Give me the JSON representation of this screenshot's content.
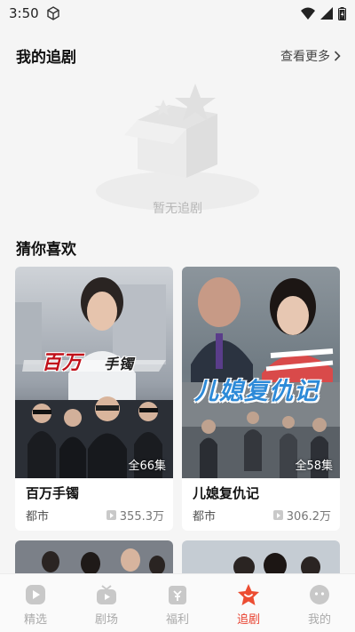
{
  "status_bar": {
    "time": "3:50"
  },
  "my_follow": {
    "title": "我的追剧",
    "more_label": "查看更多",
    "empty_text": "暂无追剧"
  },
  "recommend": {
    "title": "猜你喜欢",
    "cards": [
      {
        "title": "百万手镯",
        "genre": "都市",
        "views": "355.3万",
        "episodes": "全66集",
        "poster_text": "百万",
        "poster_text_2": "手镯"
      },
      {
        "title": "儿媳复仇记",
        "genre": "都市",
        "views": "306.2万",
        "episodes": "全58集",
        "poster_text": "儿媳复仇记"
      }
    ]
  },
  "tabs": [
    {
      "label": "精选",
      "icon": "play-circle-icon",
      "active": false
    },
    {
      "label": "剧场",
      "icon": "tv-icon",
      "active": false
    },
    {
      "label": "福利",
      "icon": "gift-icon",
      "active": false
    },
    {
      "label": "追剧",
      "icon": "star-icon",
      "active": true
    },
    {
      "label": "我的",
      "icon": "face-icon",
      "active": false
    }
  ],
  "colors": {
    "accent": "#e8412f",
    "inactive": "#aaaaaa"
  }
}
